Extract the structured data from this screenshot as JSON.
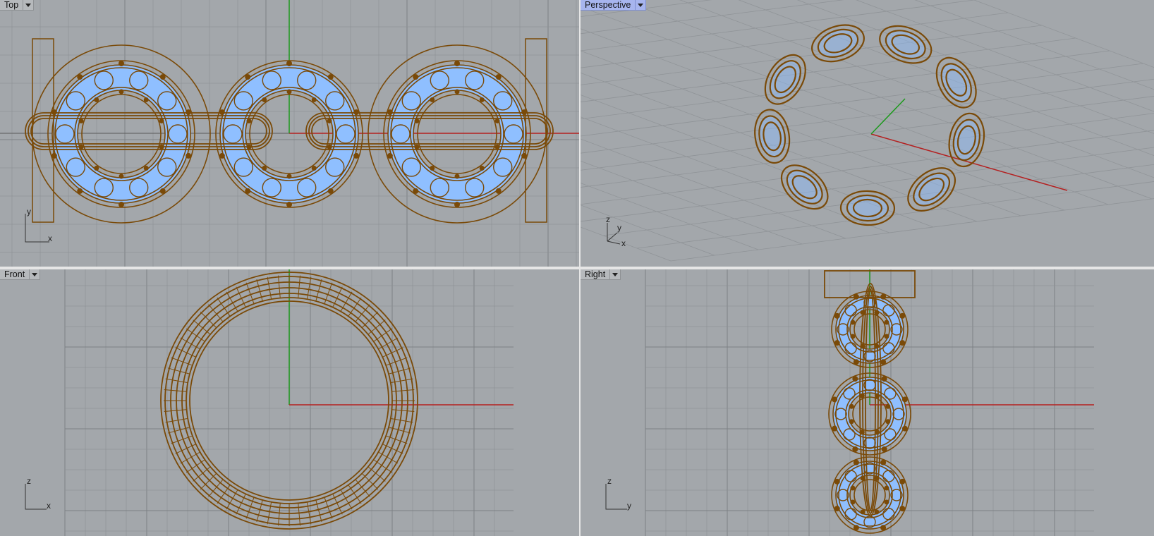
{
  "viewports": {
    "top": {
      "label": "Top",
      "axes": {
        "vertical": "y",
        "horizontal": "x"
      }
    },
    "perspective": {
      "label": "Perspective",
      "axes": {
        "vertical": "z",
        "middle": "y",
        "horizontal": "x"
      }
    },
    "front": {
      "label": "Front",
      "axes": {
        "vertical": "z",
        "horizontal": "x"
      }
    },
    "right": {
      "label": "Right",
      "axes": {
        "vertical": "z",
        "horizontal": "y"
      }
    }
  },
  "colors": {
    "background": "#a3a7ab",
    "grid": "#8f9397",
    "grid_major": "#7c8084",
    "x_axis": "#b42020",
    "y_axis": "#1d9a1d",
    "wire": "#7a4a08",
    "gem": "#8fbfff",
    "active_tab": "#a7b5ee"
  },
  "icons": {
    "tab_dropdown": "chevron-down-icon"
  }
}
